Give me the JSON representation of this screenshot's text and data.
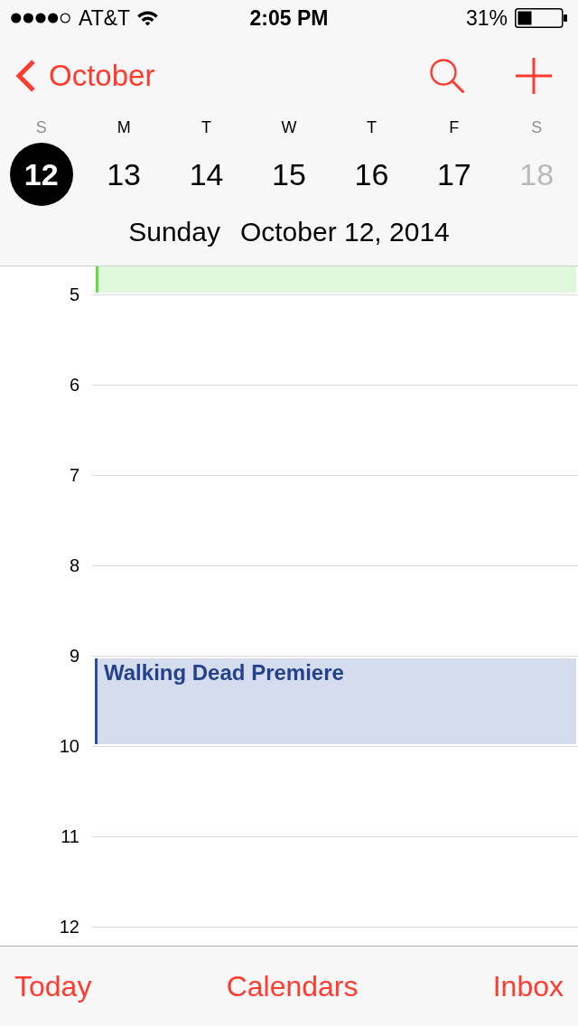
{
  "status_bar": {
    "carrier": "AT&T",
    "time": "2:05 PM",
    "battery": "31%"
  },
  "nav_bar": {
    "back_label": "October"
  },
  "week": {
    "days": [
      {
        "letter": "S",
        "date": "12",
        "selected": true,
        "dimmed": true
      },
      {
        "letter": "M",
        "date": "13",
        "selected": false,
        "dimmed": false
      },
      {
        "letter": "T",
        "date": "14",
        "selected": false,
        "dimmed": false
      },
      {
        "letter": "W",
        "date": "15",
        "selected": false,
        "dimmed": false
      },
      {
        "letter": "T",
        "date": "16",
        "selected": false,
        "dimmed": false
      },
      {
        "letter": "F",
        "date": "17",
        "selected": false,
        "dimmed": false
      },
      {
        "letter": "S",
        "date": "18",
        "selected": false,
        "dimmed": true
      }
    ]
  },
  "selected_date": {
    "weekday": "Sunday",
    "date": "October 12, 2014"
  },
  "timeline": {
    "earlier_event": {
      "color": "#62d84a"
    },
    "hours": [
      {
        "label": "5"
      },
      {
        "label": "6"
      },
      {
        "label": "7"
      },
      {
        "label": "8"
      },
      {
        "label": "9",
        "events": [
          {
            "title": "Walking Dead Premiere",
            "color": "#2a4ea3"
          }
        ]
      },
      {
        "label": "10"
      },
      {
        "label": "11"
      },
      {
        "label": "12"
      }
    ]
  },
  "toolbar": {
    "buttons": [
      "Today",
      "Calendars",
      "Inbox"
    ]
  }
}
